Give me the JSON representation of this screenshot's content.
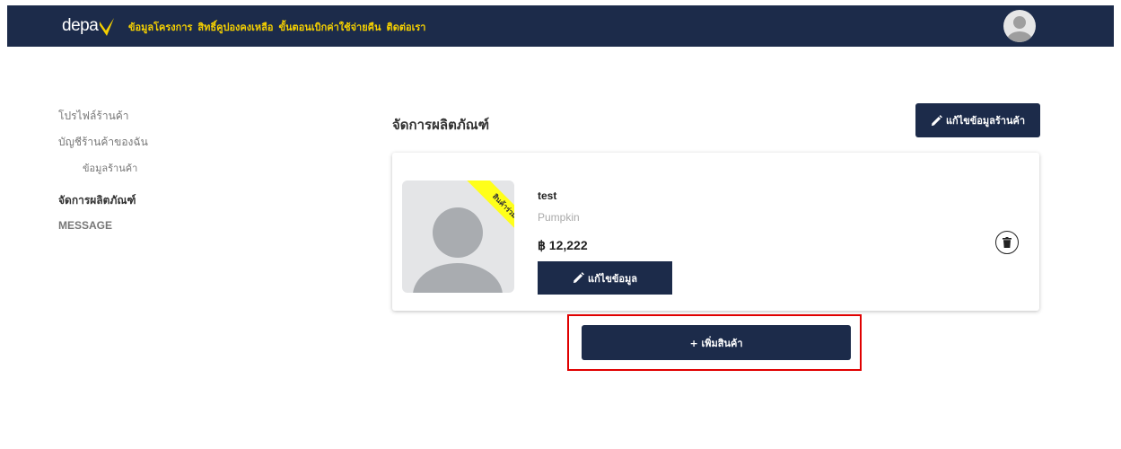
{
  "header": {
    "logo_text": "depa",
    "nav": [
      {
        "label": "ข้อมูลโครงการ"
      },
      {
        "label": "สิทธิ์คูปองคงเหลือ"
      },
      {
        "label": "ขั้นตอนเบิกค่าใช้จ่ายคืน"
      },
      {
        "label": "ติดต่อเรา"
      }
    ],
    "accent_color": "#f5d000",
    "bar_color": "#1c2b4a"
  },
  "sidebar": {
    "items": [
      {
        "label": "โปรไฟล์ร้านค้า"
      },
      {
        "label": "บัญชีร้านค้าของฉัน"
      },
      {
        "label": "ข้อมูลร้านค้า"
      },
      {
        "label": "จัดการผลิตภัณฑ์"
      },
      {
        "label": "MESSAGE"
      }
    ]
  },
  "main": {
    "title": "จัดการผลิตภัณฑ์",
    "edit_store_label": "แก้ไขข้อมูลร้านค้า",
    "product": {
      "name": "test",
      "subtitle": "Pumpkin",
      "price": "฿ 12,222",
      "ribbon": "สินค้าร่วมโครงการ",
      "edit_label": "แก้ไขข้อมูล"
    },
    "add_product_label": "+ เพิ่มสินค้า"
  }
}
